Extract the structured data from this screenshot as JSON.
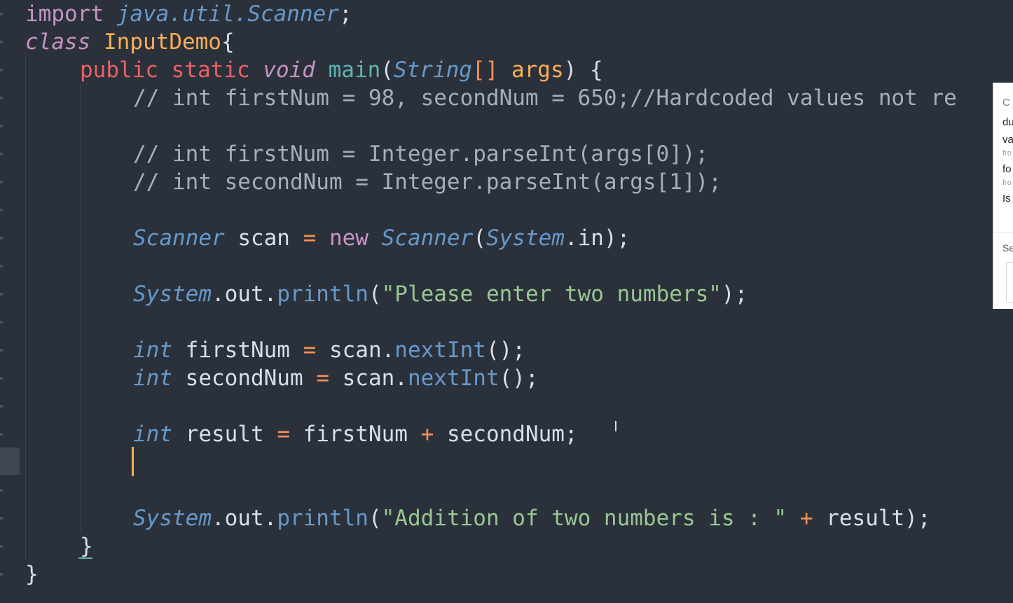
{
  "editor": {
    "lines": {
      "l1": {
        "import_kw": "import",
        "pkg": "java.util.Scanner",
        "semi": ";"
      },
      "l2": {
        "class_kw": "class",
        "class_name": "InputDemo",
        "brace": "{"
      },
      "l3": {
        "public_kw": "public",
        "static_kw": "static",
        "void_kw": "void",
        "method": "main",
        "paren_open": "(",
        "param_type": "String",
        "brackets": "[]",
        "param_name": "args",
        "paren_close": ")",
        "brace": "{"
      },
      "l4": {
        "comment": "// int firstNum = 98, secondNum = 650;//Hardcoded values not re"
      },
      "l6": {
        "comment": "// int firstNum = Integer.parseInt(args[0]);"
      },
      "l7": {
        "comment": "// int secondNum = Integer.parseInt(args[1]);"
      },
      "l9": {
        "type1": "Scanner",
        "var": " scan ",
        "eq": "=",
        "new_kw": "new",
        "type2": "Scanner",
        "paren": "(",
        "system": "System",
        "in": ".in);"
      },
      "l11": {
        "system": "System",
        "out": ".out.",
        "println": "println",
        "paren": "(",
        "str": "\"Please enter two numbers\"",
        "end": ");"
      },
      "l13": {
        "int_kw": "int",
        "var": " firstNum ",
        "eq": "=",
        "scan": " scan.",
        "next": "nextInt",
        "end": "();"
      },
      "l14": {
        "int_kw": "int",
        "var": " secondNum ",
        "eq": "=",
        "scan": " scan.",
        "next": "nextInt",
        "end": "();"
      },
      "l16": {
        "int_kw": "int",
        "var": " result ",
        "eq": "=",
        "a": " firstNum ",
        "plus": "+",
        "b": " secondNum;"
      },
      "l19": {
        "system": "System",
        "out": ".out.",
        "println": "println",
        "paren": "(",
        "str": "\"Addition of two numbers is : \"",
        "plus": "+",
        "end": " result);"
      },
      "l20": {
        "brace": "}"
      },
      "l21": {
        "brace": "}"
      }
    }
  },
  "side_panel": {
    "header": "C",
    "line1": "du",
    "line2": "va",
    "from1": "fro",
    "line3": "fo",
    "from2": "fro",
    "line4": "Is",
    "section": "Se"
  },
  "colors": {
    "background": "#2b313a",
    "keyword": "#c594c5",
    "type": "#6699cc",
    "string": "#99c794",
    "function": "#5fb3b3",
    "operator": "#f99157",
    "class_name": "#f9ae58",
    "comment": "#a7adba"
  }
}
